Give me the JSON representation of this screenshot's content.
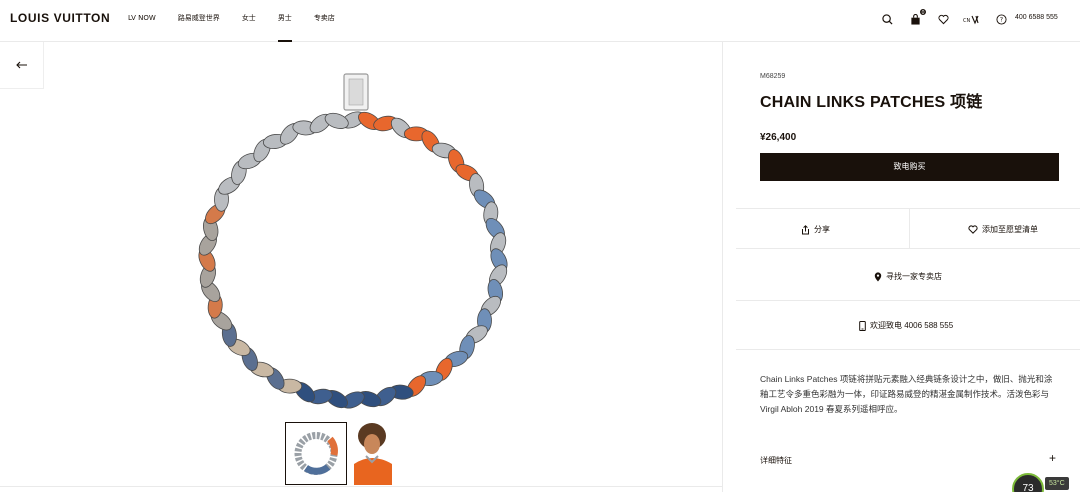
{
  "header": {
    "logo": "LOUIS VUITTON",
    "nav": [
      "LV NOW",
      "路易威登世界",
      "女士",
      "男士",
      "专卖店"
    ],
    "active_nav": "男士",
    "cart_count": "0",
    "lang_label": "中文",
    "phone": "400 6588 555"
  },
  "product": {
    "sku": "M68259",
    "title": "CHAIN LINKS PATCHES 项链",
    "price": "¥26,400",
    "buy_label": "致电购买",
    "share_label": "分享",
    "wishlist_label": "添加至愿望清单",
    "store_label": "寻找一家专卖店",
    "call_label": "欢迎致电 4006 588 555",
    "description": "Chain Links Patches 项链将拼贴元素融入经典链条设计之中，做旧、抛光和涂釉工艺令多重色彩融为一体，印证路易威登的精湛金属制作技术。活泼色彩与 Virgil Abloh 2019 春夏系列遥相呼应。",
    "details_label": "详细特征",
    "details_toggle": "+"
  },
  "widget": {
    "gauge": "73",
    "temperature": "53°C"
  },
  "colors": {
    "primary": "#19110b",
    "orange": "#e8672d",
    "blue": "#6f8fb8",
    "silver": "#b9bcc0"
  }
}
